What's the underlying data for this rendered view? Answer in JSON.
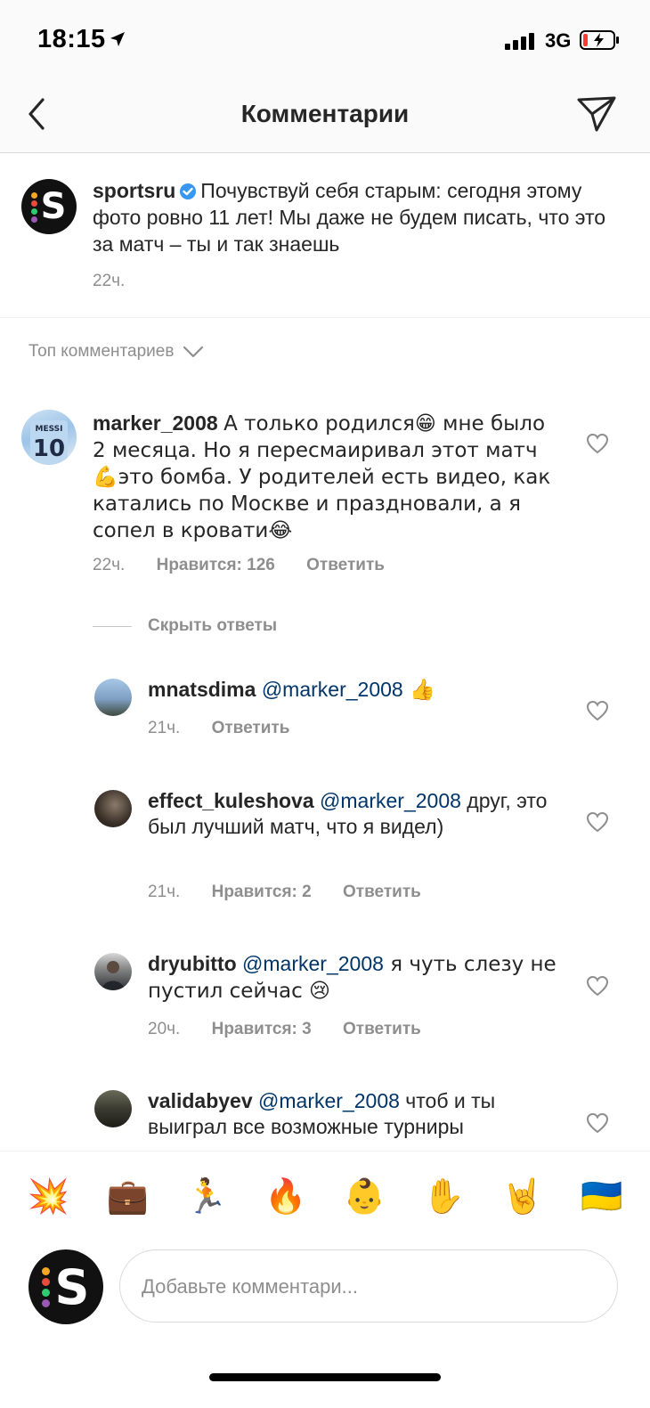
{
  "status_bar": {
    "time": "18:15",
    "network": "3G"
  },
  "header": {
    "title": "Комментарии",
    "back_icon": "chevron-left-icon",
    "send_icon": "paper-plane-icon"
  },
  "caption": {
    "username": "sportsru",
    "text": "Почувствуй себя старым: сегодня этому фото ровно 11 лет! Мы даже не будем писать, что это за матч – ты и так знаешь",
    "time": "22ч."
  },
  "sort": {
    "label": "Топ комментариев"
  },
  "comments": [
    {
      "username": "marker_2008",
      "text": "А только родился😁 мне было 2 месяца. Но я пересмаиривал этот матч💪это бомба. У родителей есть видео, как катались по Москве и праздновали, а я сопел в кровати😂",
      "time": "22ч.",
      "likes": "Нравится: 126",
      "reply": "Ответить"
    }
  ],
  "hide_replies": "Скрыть ответы",
  "replies": [
    {
      "username": "mnatsdima",
      "mention": "@marker_2008",
      "text": " 👍",
      "time": "21ч.",
      "likes": "",
      "reply": "Ответить"
    },
    {
      "username": "effect_kuleshova",
      "mention": "@marker_2008",
      "text": "друг, это был лучший матч, что я видел)",
      "time": "21ч.",
      "likes": "Нравится: 2",
      "reply": "Ответить"
    },
    {
      "username": "dryubitto",
      "mention": "@marker_2008",
      "text": " я чуть слезу не пустил сейчас 😢",
      "time": "20ч.",
      "likes": "Нравится: 3",
      "reply": "Ответить"
    },
    {
      "username": "validabyev",
      "mention": "@marker_2008",
      "text": " чтоб и ты выиграл все возможные турниры",
      "time": "",
      "likes": "",
      "reply": ""
    }
  ],
  "emoji_bar": [
    "💥",
    "💼",
    "🏃",
    "🔥",
    "👶",
    "✋",
    "🤘",
    "🇺🇦"
  ],
  "input": {
    "placeholder": "Добавьте комментари..."
  },
  "colors": {
    "mention": "#003569",
    "muted": "#8e8e8e",
    "text": "#262626",
    "verified": "#3897f0"
  }
}
